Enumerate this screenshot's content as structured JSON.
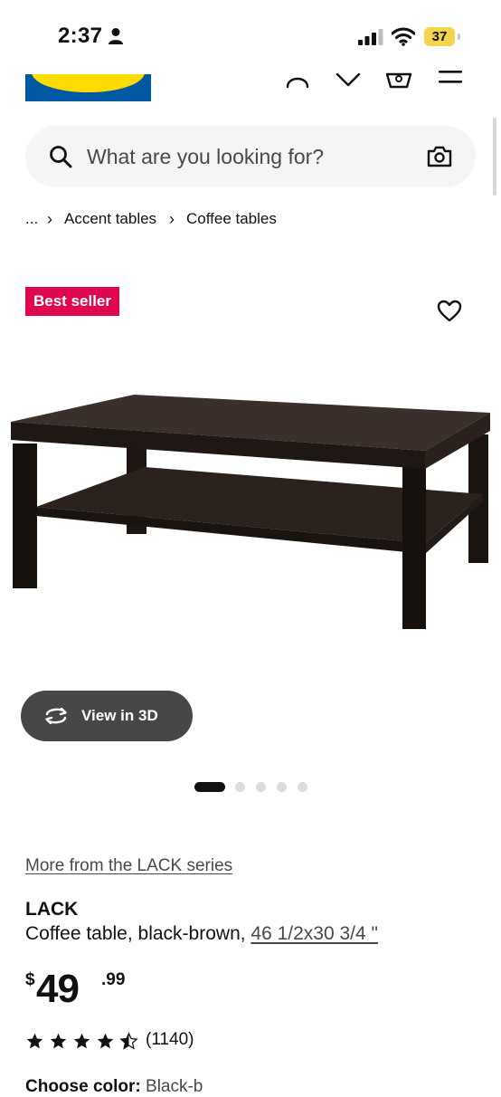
{
  "status_bar": {
    "time": "2:37",
    "battery": "37"
  },
  "header": {
    "brand": "IKEA"
  },
  "search": {
    "placeholder": "What are you looking for?"
  },
  "breadcrumb": {
    "items": [
      "...",
      "Accent tables",
      "Coffee tables"
    ]
  },
  "product": {
    "badge": "Best seller",
    "view3d_label": "View in 3D",
    "carousel": {
      "count": 5,
      "active": 0
    },
    "series_link": "More from the LACK series",
    "name": "LACK",
    "description": "Coffee table, black-brown, ",
    "dimensions": "46 1/2x30 3/4 \"",
    "price": {
      "currency": "$",
      "whole": "49",
      "cents": ".99"
    },
    "rating": 4.5,
    "review_count": "(1140)",
    "choose_color_label": "Choose color",
    "choose_color_value": "Black-b"
  },
  "colors": {
    "badge": "#e00751",
    "logo_blue": "#0058a3",
    "logo_yellow": "#ffdb00",
    "view3d_bg": "#474747"
  }
}
